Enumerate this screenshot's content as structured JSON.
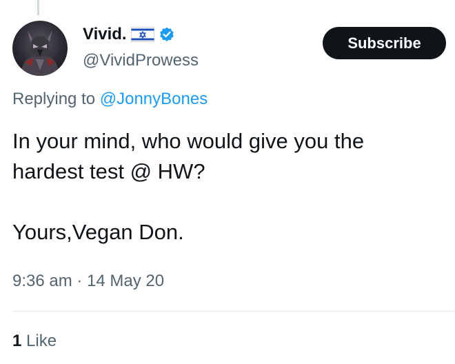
{
  "author": {
    "display_name": "Vivid.",
    "flag_emoji": "🇮🇱",
    "handle": "@VividProwess",
    "verified": true
  },
  "subscribe_label": "Subscribe",
  "reply": {
    "prefix": "Replying to ",
    "mention": "@JonnyBones"
  },
  "tweet": {
    "line1": "In your mind, who would give you the",
    "line2": "hardest test @ HW?",
    "line3": "Yours,Vegan Don."
  },
  "meta": {
    "time": "9:36 am",
    "separator": " · ",
    "date": "14 May 20"
  },
  "stats": {
    "like_count": "1",
    "like_label": " Like"
  },
  "colors": {
    "text": "#0f1419",
    "secondary": "#536471",
    "link": "#1d9bf0",
    "verified": "#1d9bf0",
    "button_bg": "#0f1419",
    "divider": "#e1e8ed"
  }
}
